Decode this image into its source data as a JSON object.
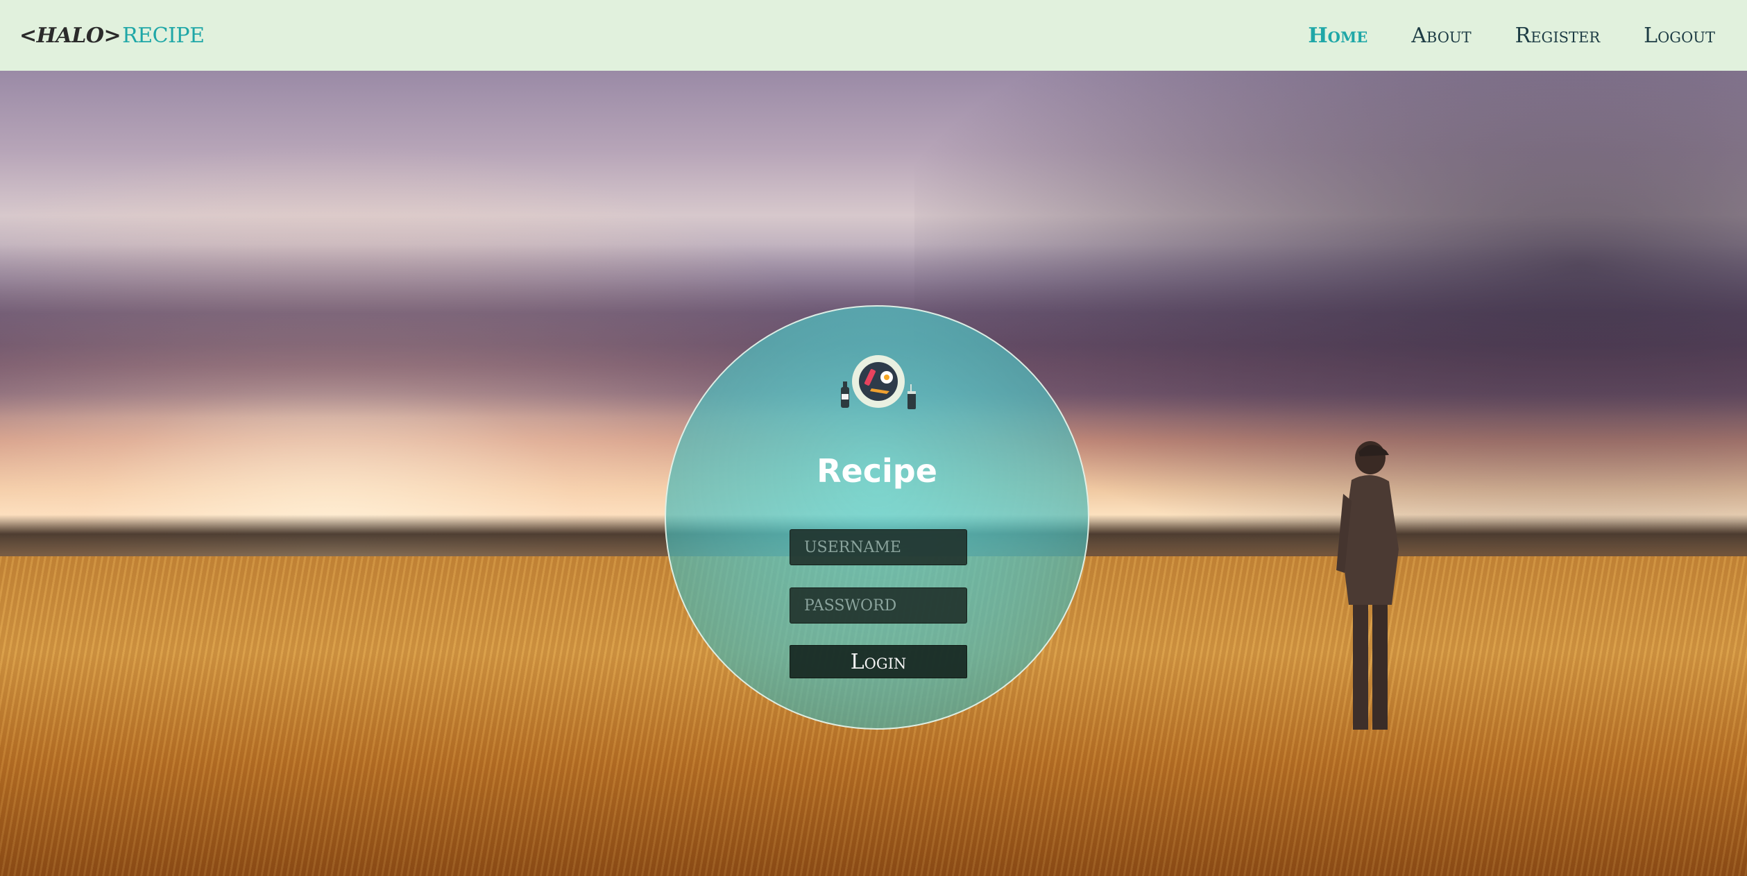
{
  "brand": {
    "prefix": "<HALO>",
    "name": "RECIPE"
  },
  "nav": {
    "items": [
      {
        "label": "Home",
        "active": true
      },
      {
        "label": "About",
        "active": false
      },
      {
        "label": "Register",
        "active": false
      },
      {
        "label": "Logout",
        "active": false
      }
    ]
  },
  "login": {
    "title": "Recipe",
    "username_placeholder": "USERNAME",
    "password_placeholder": "PASSWORD",
    "button_label": "Login",
    "logo_icon": "breakfast-plate-icon"
  },
  "colors": {
    "navbar_bg": "#e1f1dd",
    "accent": "#1fa7a7",
    "nav_text": "#1d3c44",
    "circle_fill": "#5fd7d7"
  }
}
